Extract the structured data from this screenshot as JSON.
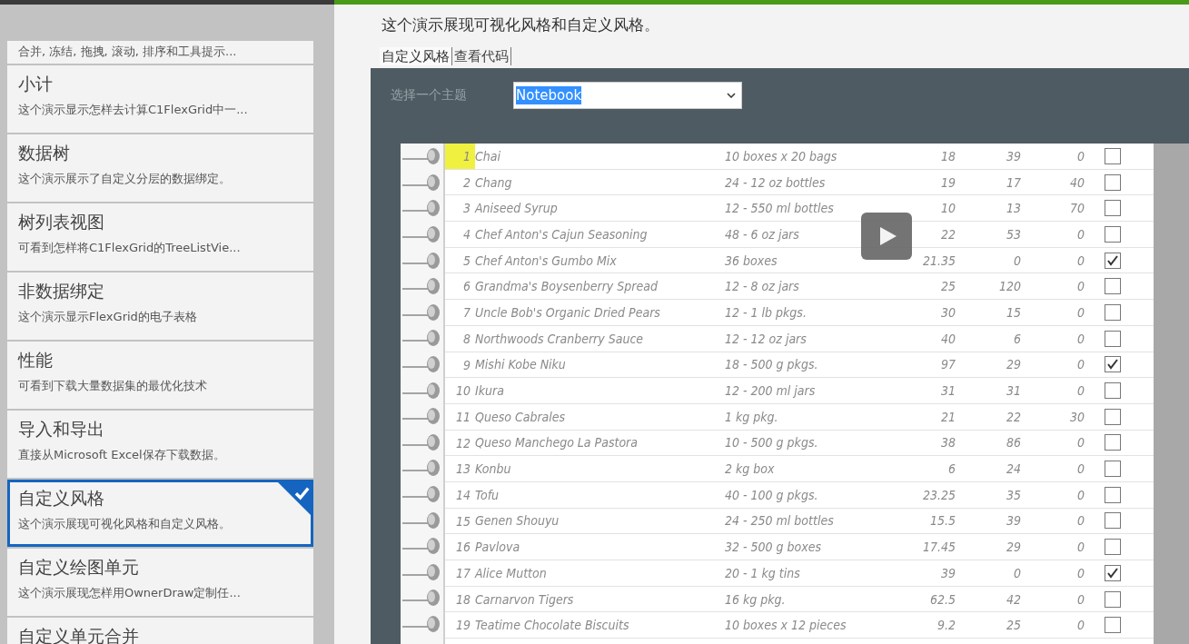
{
  "sidebar": {
    "items": [
      {
        "description": "合并, 冻结, 拖拽, 滚动, 排序和工具提示...",
        "selected": false
      },
      {
        "title": "小计",
        "description": "这个演示显示怎样去计算C1FlexGrid中一...",
        "selected": false
      },
      {
        "title": "数据树",
        "description": "这个演示展示了自定义分层的数据绑定。",
        "selected": false
      },
      {
        "title": "树列表视图",
        "description": "可看到怎样将C1FlexGrid的TreeListVie...",
        "selected": false
      },
      {
        "title": "非数据绑定",
        "description": "这个演示显示FlexGrid的电子表格",
        "selected": false
      },
      {
        "title": "性能",
        "description": "可看到下载大量数据集的最优化技术",
        "selected": false
      },
      {
        "title": "导入和导出",
        "description": "直接从Microsoft Excel保存下载数据。",
        "selected": false
      },
      {
        "title": "自定义风格",
        "description": "这个演示展现可视化风格和自定义风格。",
        "selected": true
      },
      {
        "title": "自定义绘图单元",
        "description": "这个演示展现怎样用OwnerDraw定制任...",
        "selected": false
      },
      {
        "title": "自定义单元合并",
        "selected": false
      }
    ]
  },
  "description": "这个演示展现可视化风格和自定义风格。",
  "tabs": [
    {
      "label": "自定义风格",
      "selected": true
    },
    {
      "label": "查看代码",
      "selected": false
    }
  ],
  "theme_label": "选择一个主题",
  "theme_select": {
    "value": "Notebook"
  },
  "grid": {
    "rows": [
      {
        "id": "1",
        "name": "Chai",
        "qty": "10 boxes x 20 bags",
        "price": "18",
        "stock": "39",
        "order": "0",
        "checked": false,
        "selected": true
      },
      {
        "id": "2",
        "name": "Chang",
        "qty": "24 - 12 oz bottles",
        "price": "19",
        "stock": "17",
        "order": "40",
        "checked": false,
        "selected": false
      },
      {
        "id": "3",
        "name": "Aniseed Syrup",
        "qty": "12 - 550 ml bottles",
        "price": "10",
        "stock": "13",
        "order": "70",
        "checked": false,
        "selected": false
      },
      {
        "id": "4",
        "name": "Chef Anton's Cajun Seasoning",
        "qty": "48 - 6 oz jars",
        "price": "22",
        "stock": "53",
        "order": "0",
        "checked": false,
        "selected": false
      },
      {
        "id": "5",
        "name": "Chef Anton's Gumbo Mix",
        "qty": "36 boxes",
        "price": "21.35",
        "stock": "0",
        "order": "0",
        "checked": true,
        "selected": false
      },
      {
        "id": "6",
        "name": "Grandma's Boysenberry Spread",
        "qty": "12 - 8 oz jars",
        "price": "25",
        "stock": "120",
        "order": "0",
        "checked": false,
        "selected": false
      },
      {
        "id": "7",
        "name": "Uncle Bob's Organic Dried Pears",
        "qty": "12 - 1 lb pkgs.",
        "price": "30",
        "stock": "15",
        "order": "0",
        "checked": false,
        "selected": false
      },
      {
        "id": "8",
        "name": "Northwoods Cranberry Sauce",
        "qty": "12 - 12 oz jars",
        "price": "40",
        "stock": "6",
        "order": "0",
        "checked": false,
        "selected": false
      },
      {
        "id": "9",
        "name": "Mishi Kobe Niku",
        "qty": "18 - 500 g pkgs.",
        "price": "97",
        "stock": "29",
        "order": "0",
        "checked": true,
        "selected": false
      },
      {
        "id": "10",
        "name": "Ikura",
        "qty": "12 - 200 ml jars",
        "price": "31",
        "stock": "31",
        "order": "0",
        "checked": false,
        "selected": false
      },
      {
        "id": "11",
        "name": "Queso Cabrales",
        "qty": "1 kg pkg.",
        "price": "21",
        "stock": "22",
        "order": "30",
        "checked": false,
        "selected": false
      },
      {
        "id": "12",
        "name": "Queso Manchego La Pastora",
        "qty": "10 - 500 g pkgs.",
        "price": "38",
        "stock": "86",
        "order": "0",
        "checked": false,
        "selected": false
      },
      {
        "id": "13",
        "name": "Konbu",
        "qty": "2 kg box",
        "price": "6",
        "stock": "24",
        "order": "0",
        "checked": false,
        "selected": false
      },
      {
        "id": "14",
        "name": "Tofu",
        "qty": "40 - 100 g pkgs.",
        "price": "23.25",
        "stock": "35",
        "order": "0",
        "checked": false,
        "selected": false
      },
      {
        "id": "15",
        "name": "Genen Shouyu",
        "qty": "24 - 250 ml bottles",
        "price": "15.5",
        "stock": "39",
        "order": "0",
        "checked": false,
        "selected": false
      },
      {
        "id": "16",
        "name": "Pavlova",
        "qty": "32 - 500 g boxes",
        "price": "17.45",
        "stock": "29",
        "order": "0",
        "checked": false,
        "selected": false
      },
      {
        "id": "17",
        "name": "Alice Mutton",
        "qty": "20 - 1 kg tins",
        "price": "39",
        "stock": "0",
        "order": "0",
        "checked": true,
        "selected": false
      },
      {
        "id": "18",
        "name": "Carnarvon Tigers",
        "qty": "16 kg pkg.",
        "price": "62.5",
        "stock": "42",
        "order": "0",
        "checked": false,
        "selected": false
      },
      {
        "id": "19",
        "name": "Teatime Chocolate Biscuits",
        "qty": "10 boxes x 12 pieces",
        "price": "9.2",
        "stock": "25",
        "order": "0",
        "checked": false,
        "selected": false
      }
    ]
  }
}
